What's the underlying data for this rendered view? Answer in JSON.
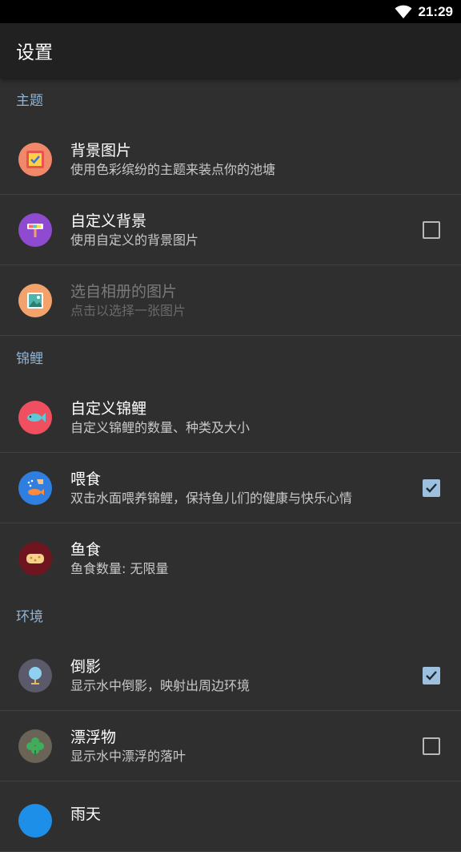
{
  "status": {
    "time": "21:29"
  },
  "app_bar": {
    "title": "设置"
  },
  "sections": [
    {
      "header": "主题"
    },
    {
      "header": "锦鲤"
    },
    {
      "header": "环境"
    }
  ],
  "items": {
    "bg_image": {
      "title": "背景图片",
      "subtitle": "使用色彩缤纷的主题来装点你的池塘"
    },
    "custom_bg": {
      "title": "自定义背景",
      "subtitle": "使用自定义的背景图片",
      "checked": false
    },
    "album_pick": {
      "title": "选自相册的图片",
      "subtitle": "点击以选择一张图片",
      "enabled": false
    },
    "custom_koi": {
      "title": "自定义锦鲤",
      "subtitle": "自定义锦鲤的数量、种类及大小"
    },
    "feed": {
      "title": "喂食",
      "subtitle": "双击水面喂养锦鲤，保持鱼儿们的健康与快乐心情",
      "checked": true
    },
    "fish_food": {
      "title": "鱼食",
      "subtitle": "鱼食数量: 无限量"
    },
    "reflection": {
      "title": "倒影",
      "subtitle": "显示水中倒影，映射出周边环境",
      "checked": true
    },
    "floating": {
      "title": "漂浮物",
      "subtitle": "显示水中漂浮的落叶",
      "checked": false
    },
    "rain": {
      "title": "雨天"
    }
  },
  "icons": {
    "bg_image": "picture-frame-icon",
    "custom_bg": "paint-roller-icon",
    "album_pick": "gallery-icon",
    "custom_koi": "fish-icon",
    "feed": "feeding-hand-icon",
    "fish_food": "food-sponge-icon",
    "reflection": "tree-mirror-icon",
    "floating": "clover-leaf-icon",
    "rain": "rain-icon"
  },
  "colors": {
    "accent": "#9cc0de",
    "section_header": "#8fb4d6",
    "background": "#2f2f2f",
    "app_bar": "#212121"
  }
}
